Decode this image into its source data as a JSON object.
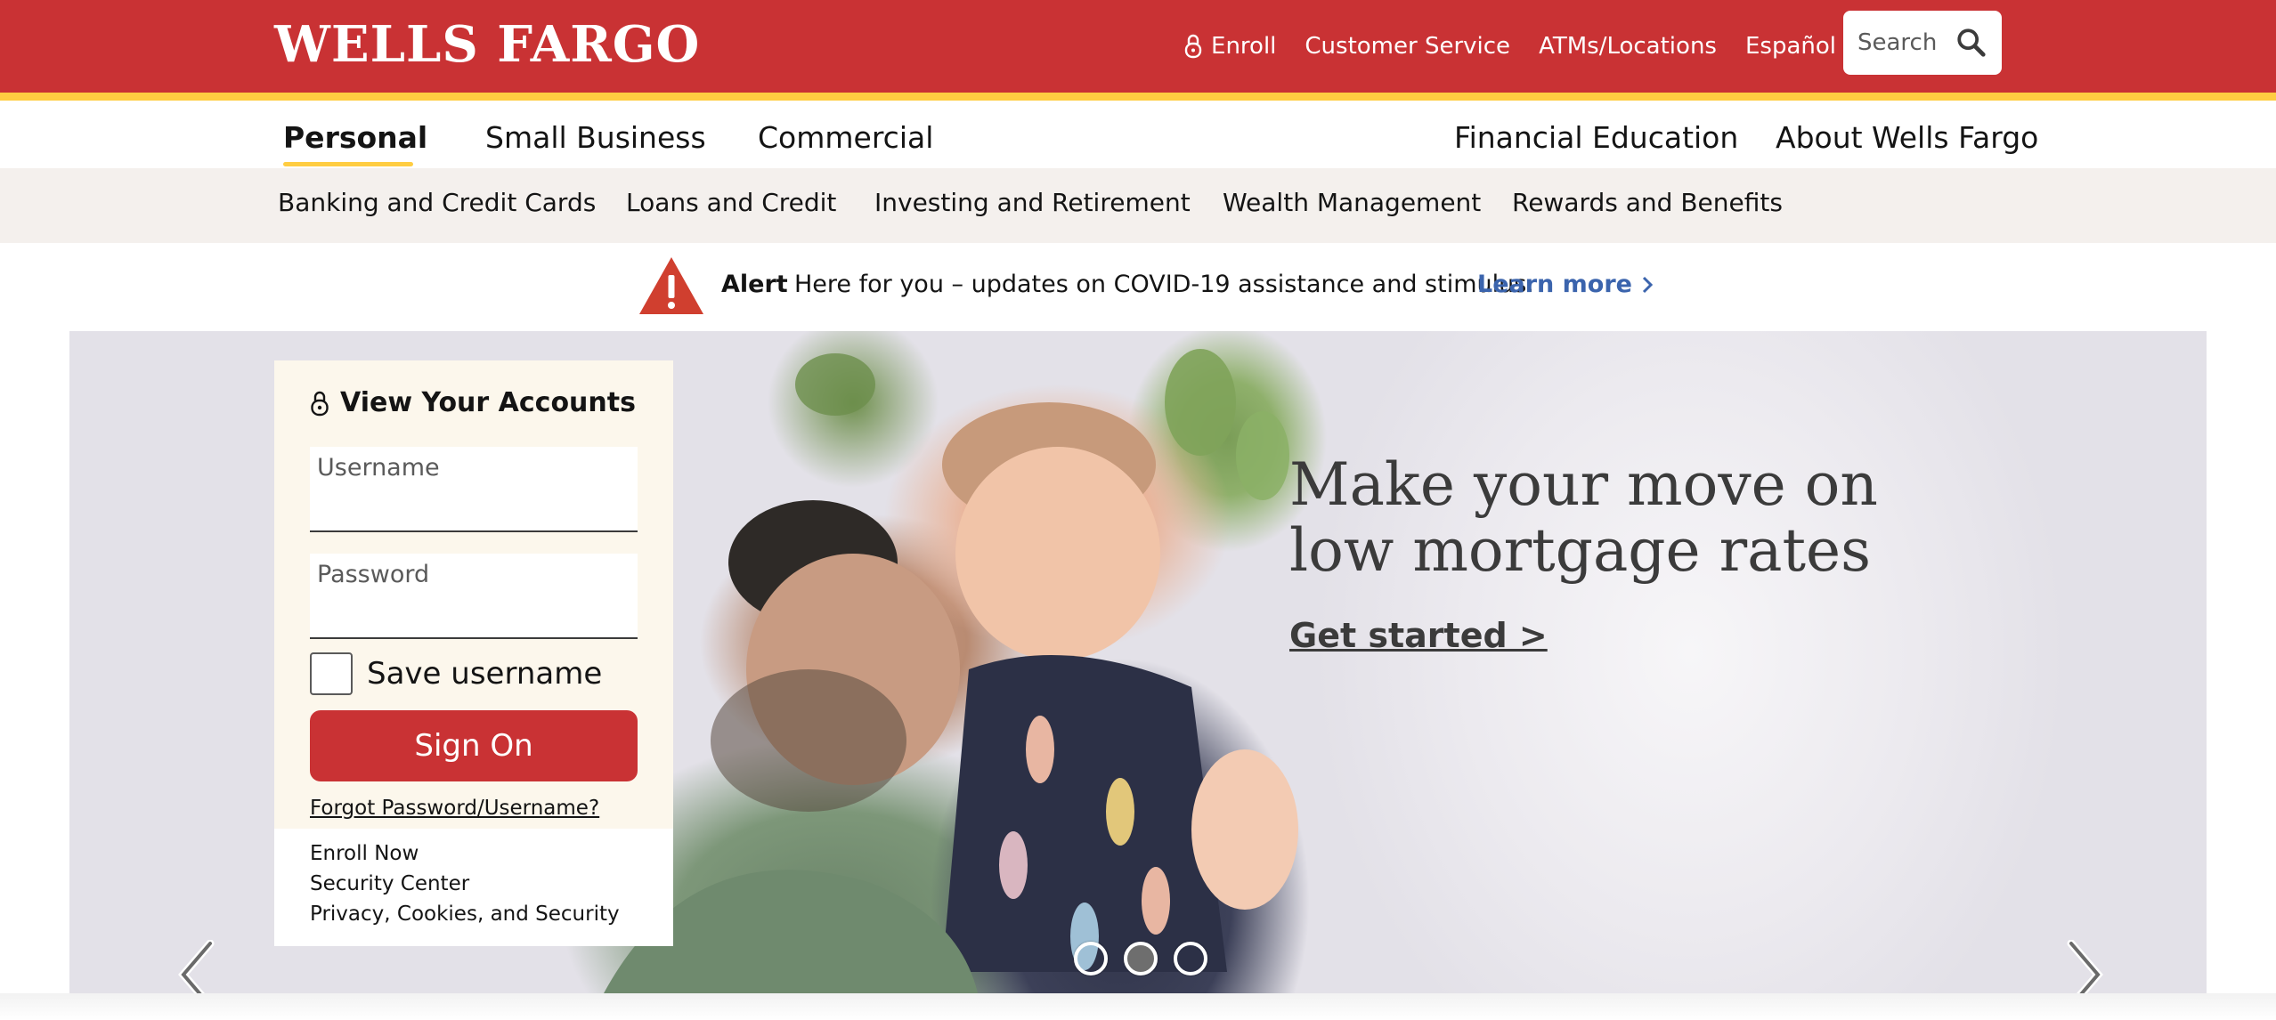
{
  "header": {
    "logo": "WELLS FARGO",
    "utility_links": [
      {
        "label": "Enroll",
        "icon": "lock-icon"
      },
      {
        "label": "Customer Service"
      },
      {
        "label": "ATMs/Locations"
      },
      {
        "label": "Español"
      }
    ],
    "search": {
      "placeholder": "Search",
      "icon": "search-icon"
    }
  },
  "primary_nav": {
    "left": [
      "Personal",
      "Small Business",
      "Commercial"
    ],
    "right": [
      "Financial Education",
      "About Wells Fargo"
    ],
    "active": "Personal"
  },
  "secondary_nav": [
    "Banking and Credit Cards",
    "Loans and Credit",
    "Investing and Retirement",
    "Wealth Management",
    "Rewards and Benefits"
  ],
  "alert": {
    "icon": "warning-icon",
    "label": "Alert",
    "text": "Here for you – updates on COVID-19 assistance and stimulus.",
    "link": "Learn more"
  },
  "signon": {
    "title": "View Your Accounts",
    "username_label": "Username",
    "password_label": "Password",
    "save_username_label": "Save username",
    "button": "Sign On",
    "forgot": "Forgot Password/Username?",
    "links": [
      "Enroll Now",
      "Security Center",
      "Privacy, Cookies, and Security"
    ]
  },
  "hero": {
    "headline_line1": "Make your move on",
    "headline_line2": "low mortgage rates",
    "cta": "Get started >",
    "slide_count": 3,
    "active_slide": 2
  },
  "colors": {
    "brand_red": "#c93234",
    "brand_gold": "#ffcd41",
    "link_blue": "#3b64ad",
    "panel_cream": "#fcf7ec",
    "subnav_bg": "#f4f0ed"
  }
}
